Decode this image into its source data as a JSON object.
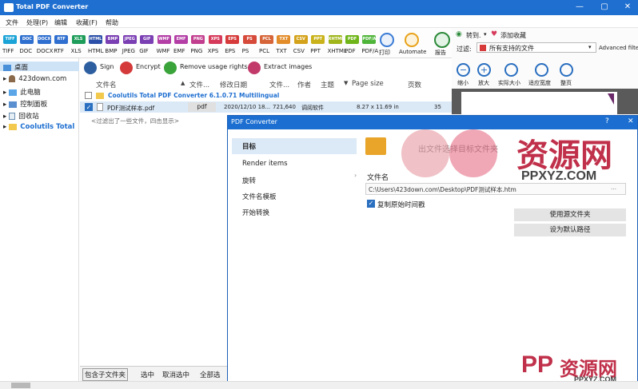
{
  "window": {
    "title": "Total PDF Converter",
    "min_glyph": "—",
    "max_glyph": "▢",
    "close_glyph": "✕"
  },
  "menu": [
    "文件",
    "处理(P)",
    "编辑",
    "收藏(F)",
    "帮助"
  ],
  "formats": [
    {
      "label": "TIFF",
      "color": "#1aa3d6"
    },
    {
      "label": "DOC",
      "color": "#2f6fcf"
    },
    {
      "label": "DOCX",
      "color": "#2f6fcf"
    },
    {
      "label": "RTF",
      "color": "#2f6fcf"
    },
    {
      "label": "XLS",
      "color": "#1e9d5a"
    },
    {
      "label": "HTML",
      "color": "#2b4fa8"
    },
    {
      "label": "BMP",
      "color": "#7a3fb3"
    },
    {
      "label": "JPEG",
      "color": "#7a3fb3"
    },
    {
      "label": "GIF",
      "color": "#7a3fb3"
    },
    {
      "label": "WMF",
      "color": "#b33fa6"
    },
    {
      "label": "EMF",
      "color": "#b33fa6"
    },
    {
      "label": "PNG",
      "color": "#c23f8f"
    },
    {
      "label": "XPS",
      "color": "#d63a5a"
    },
    {
      "label": "EPS",
      "color": "#d63a3a"
    },
    {
      "label": "PS",
      "color": "#d64a3a"
    },
    {
      "label": "PCL",
      "color": "#d6663a"
    },
    {
      "label": "TXT",
      "color": "#e38c2a"
    },
    {
      "label": "CSV",
      "color": "#d4a21a"
    },
    {
      "label": "PPT",
      "color": "#c9b21a"
    },
    {
      "label": "XHTML",
      "color": "#9fb51a"
    },
    {
      "label": "PDF",
      "color": "#6fb51a"
    },
    {
      "label": "PDF/A",
      "color": "#4fb53a"
    }
  ],
  "toolbar_extra": {
    "print": "打印",
    "automate": "Automate",
    "report": "报告"
  },
  "actions": {
    "sign": "Sign",
    "encrypt": "Encrypt",
    "remove": "Remove usage rights",
    "extract": "Extract images"
  },
  "tree": [
    "桌面",
    "423down.com",
    "此电脑",
    "控制面板",
    "回收站",
    "Coolutils Total"
  ],
  "columns": {
    "name": "文件名",
    "type": "文件...",
    "date": "修改日期",
    "size": "文件...",
    "author": "作者",
    "subject": "主题",
    "pagesize": "Page size",
    "pages": "页数"
  },
  "folder_row": "Coolutils Total PDF Converter 6.1.0.71 Multilingual",
  "file_row": {
    "name": "PDF测试样本.pdf",
    "type": "pdf",
    "date": "2020/12/10 18...",
    "size": "721,640",
    "author": "调阅软件",
    "pagesize": "8.27 x 11.69 in",
    "pages": "35"
  },
  "filter_hint": "<过滤出了一些文件，四击显示>",
  "bottom": {
    "include_sub": "包含子文件夹",
    "select": "选中",
    "unselect": "取消选中",
    "select_all": "全部选"
  },
  "right": {
    "goto": "转到.",
    "add_fav": "添加收藏",
    "filter_label": "过滤:",
    "filter_value": "所有支持的文件",
    "advanced": "Advanced filter",
    "zoom_out": "缩小",
    "zoom_in": "放大",
    "actual": "实际大小",
    "fit_width": "适应宽度",
    "full_page": "整页"
  },
  "dialog": {
    "title": "PDF Converter",
    "help": "?",
    "close": "✕",
    "nav": [
      "目标",
      "Render items",
      "旋转",
      "文件名模板",
      "开始转换"
    ],
    "header_text": "出文件选择目标文件夹",
    "filename_label": "文件名",
    "path": "C:\\Users\\423down.com\\Desktop\\PDF测试样本.htm",
    "copy_timestamp": "复制原始时间戳",
    "use_source": "使用源文件夹",
    "set_default": "设为默认路径"
  },
  "watermark": {
    "brand": "资源网",
    "url": "PPXYZ.COM",
    "mark": "PP"
  }
}
